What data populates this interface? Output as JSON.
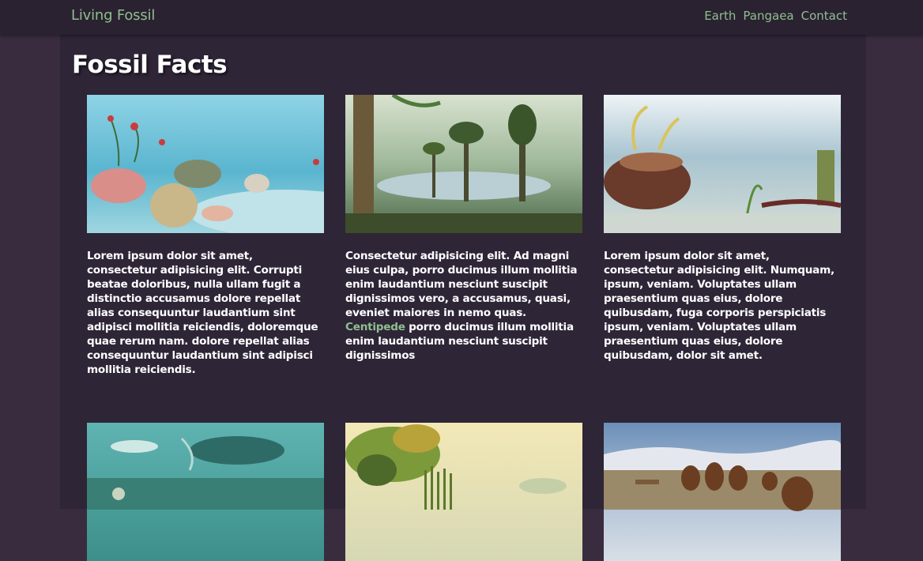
{
  "nav": {
    "brand": "Living Fossil",
    "links": [
      "Earth",
      "Pangaea",
      "Contact"
    ]
  },
  "page": {
    "title": "Fossil Facts"
  },
  "cards": [
    {
      "image": "undersea-reef-painting",
      "text": "Lorem ipsum dolor sit amet, consectetur adipisicing elit. Corrupti beatae doloribus, nulla ullam fugit a distinctio accusamus dolore repellat alias consequuntur laudantium sint adipisci mollitia reiciendis, doloremque quae rerum nam. dolore repellat alias consequuntur laudantium sint adipisci mollitia reiciendis."
    },
    {
      "image": "carboniferous-forest-painting",
      "text_before": "Consectetur adipisicing elit. Ad magni eius culpa, porro ducimus illum mollitia enim laudantium nesciunt suscipit dignissimos vero, a accusamus, quasi, eveniet maiores in nemo quas.",
      "link": "Centipede",
      "text_after": "porro ducimus illum mollitia enim laudantium nesciunt suscipit dignissimos"
    },
    {
      "image": "devonian-seafloor-painting",
      "text": "Lorem ipsum dolor sit amet, consectetur adipisicing elit. Numquam, ipsum, veniam. Voluptates ullam praesentium quas eius, dolore quibusdam, fuga corporis perspiciatis ipsum, veniam. Voluptates ullam praesentium quas eius, dolore quibusdam, dolor sit amet."
    },
    {
      "image": "ancient-marine-reptile-painting"
    },
    {
      "image": "horsetail-swamp-painting"
    },
    {
      "image": "ice-age-mammoths-painting"
    }
  ]
}
